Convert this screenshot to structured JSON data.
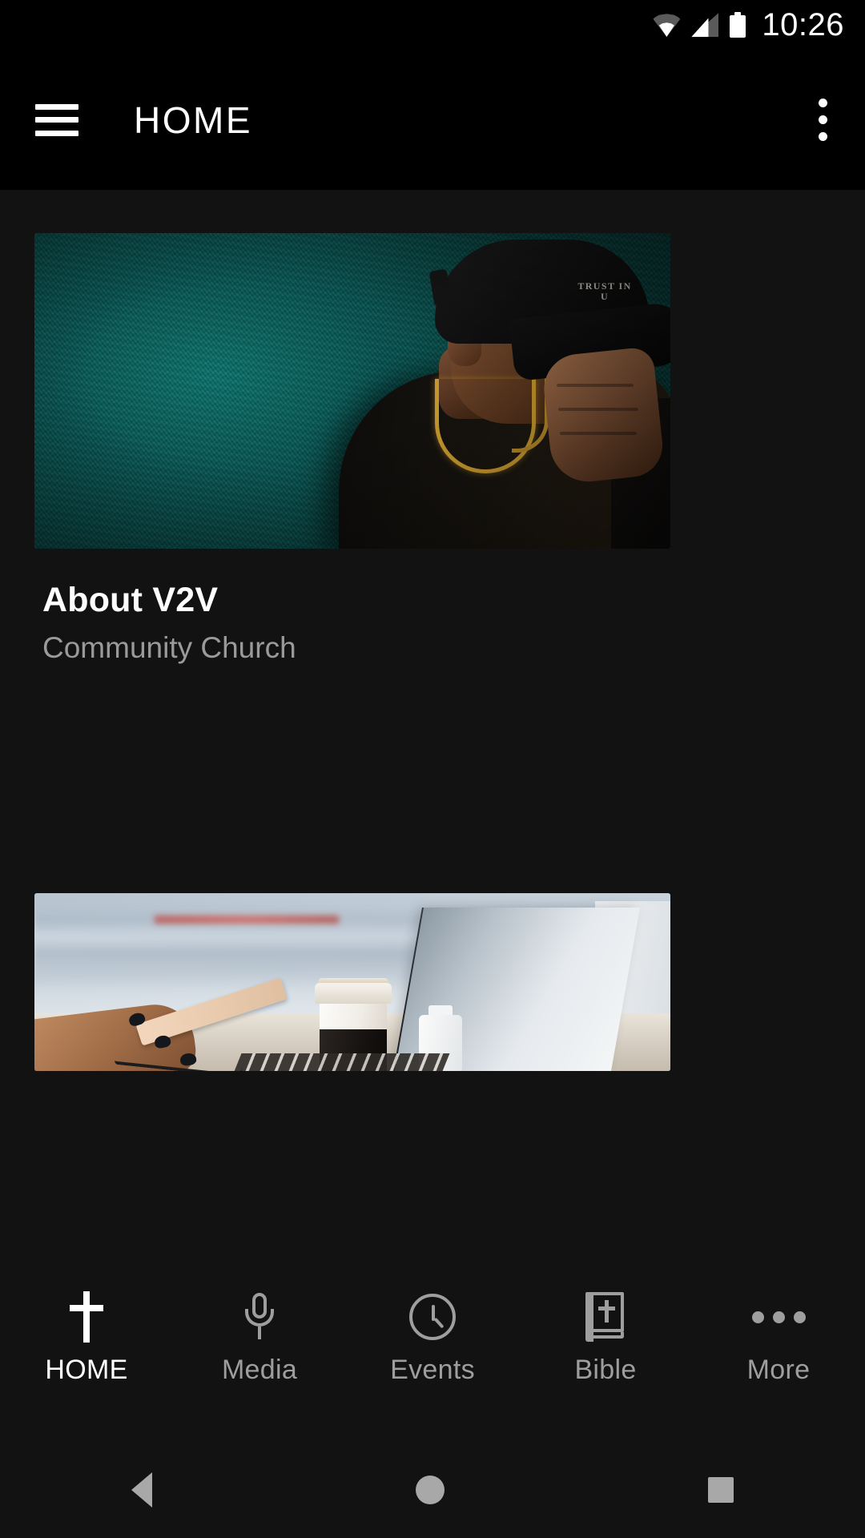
{
  "status_bar": {
    "time": "10:26",
    "icons": [
      "wifi-icon",
      "cellular-signal-icon",
      "battery-icon"
    ]
  },
  "app_bar": {
    "menu_icon": "hamburger-menu-icon",
    "title": "HOME",
    "overflow_icon": "overflow-menu-icon"
  },
  "cards": [
    {
      "image_alt": "man-in-black-cap-against-teal-wall",
      "title": "About V2V",
      "subtitle": "Community Church",
      "cap_text": "TRUST\nIN U"
    },
    {
      "image_alt": "hands-typing-on-laptop-with-coffee-cup",
      "title": "",
      "subtitle": ""
    }
  ],
  "tab_bar": {
    "items": [
      {
        "label": "HOME",
        "icon": "cross-icon",
        "active": true
      },
      {
        "label": "Media",
        "icon": "microphone-icon",
        "active": false
      },
      {
        "label": "Events",
        "icon": "clock-icon",
        "active": false
      },
      {
        "label": "Bible",
        "icon": "bible-book-icon",
        "active": false
      },
      {
        "label": "More",
        "icon": "ellipsis-icon",
        "active": false
      }
    ]
  },
  "android_nav": {
    "back": "back-triangle-icon",
    "home": "home-circle-icon",
    "recents": "recents-square-icon"
  },
  "colors": {
    "background": "#121212",
    "app_bar": "#000000",
    "active_tab_text": "#ffffff",
    "inactive_tab_text": "#9e9e9e",
    "subtitle_text": "#9a9a9a",
    "hero_accent_teal": "#0c716c"
  }
}
